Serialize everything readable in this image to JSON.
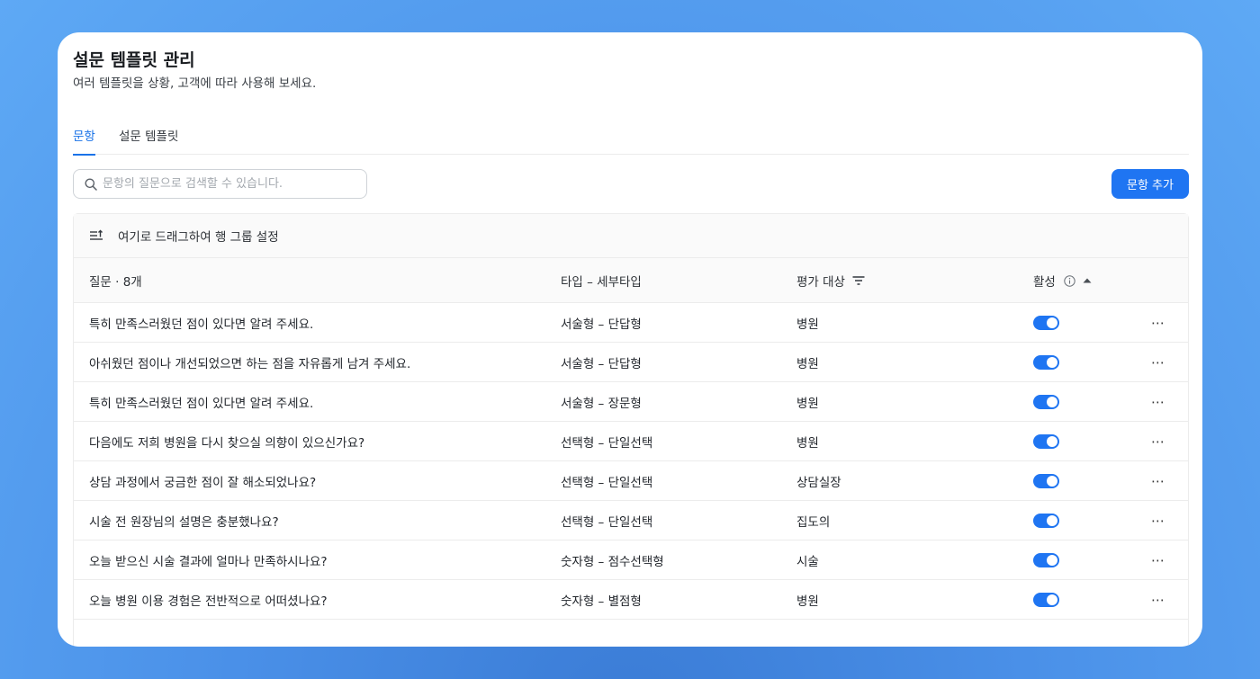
{
  "header": {
    "title": "설문 템플릿 관리",
    "subtitle": "여러 템플릿을 상황, 고객에 따라 사용해 보세요."
  },
  "tabs": [
    {
      "label": "문항",
      "active": true
    },
    {
      "label": "설문 템플릿",
      "active": false
    }
  ],
  "search": {
    "placeholder": "문항의 질문으로 검색할 수 있습니다.",
    "value": ""
  },
  "add_button": {
    "label": "문항 추가"
  },
  "group_bar": {
    "label": "여기로 드래그하여 행 그룹 설정"
  },
  "columns": {
    "question": "질문 · 8개",
    "type": "타입 – 세부타입",
    "target": "평가 대상",
    "active": "활성"
  },
  "rows": [
    {
      "question": "특히 만족스러웠던 점이 있다면 알려 주세요.",
      "type": "서술형 – 단답형",
      "target": "병원",
      "active": true
    },
    {
      "question": "아쉬웠던 점이나 개선되었으면 하는 점을 자유롭게 남겨 주세요.",
      "type": "서술형 – 단답형",
      "target": "병원",
      "active": true
    },
    {
      "question": "특히 만족스러웠던 점이 있다면 알려 주세요.",
      "type": "서술형 – 장문형",
      "target": "병원",
      "active": true
    },
    {
      "question": "다음에도 저희 병원을 다시 찾으실 의향이 있으신가요?",
      "type": "선택형 – 단일선택",
      "target": "병원",
      "active": true
    },
    {
      "question": "상담 과정에서 궁금한 점이 잘 해소되었나요?",
      "type": "선택형 – 단일선택",
      "target": "상담실장",
      "active": true
    },
    {
      "question": "시술 전 원장님의 설명은 충분했나요?",
      "type": "선택형 – 단일선택",
      "target": "집도의",
      "active": true
    },
    {
      "question": "오늘 받으신 시술 결과에 얼마나 만족하시나요?",
      "type": "숫자형 – 점수선택형",
      "target": "시술",
      "active": true
    },
    {
      "question": "오늘 병원 이용 경험은 전반적으로 어떠셨나요?",
      "type": "숫자형 – 별점형",
      "target": "병원",
      "active": true
    }
  ],
  "row_menu_glyph": "⋯",
  "colors": {
    "accent": "#1f75f2",
    "tab_active": "#1a73e8"
  }
}
